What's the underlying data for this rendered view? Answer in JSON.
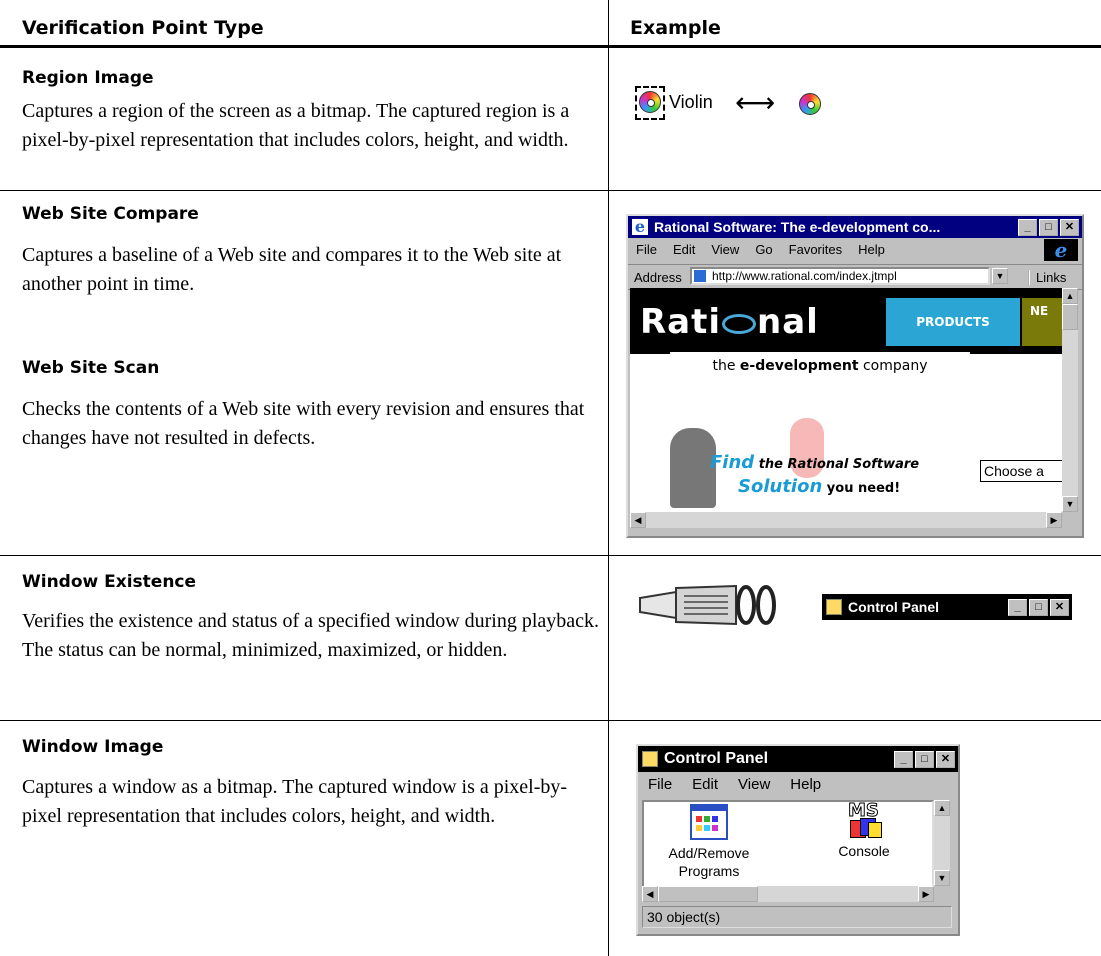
{
  "header": {
    "col1": "Verification Point Type",
    "col2": "Example"
  },
  "rows": [
    {
      "title": "Region Image",
      "desc": "Captures a region of the screen as a bitmap. The captured region is a pixel-by-pixel representation that includes colors, height, and width.",
      "example": {
        "label": "Violin",
        "arrow": "⟷"
      }
    },
    {
      "title": "Web Site Compare",
      "desc": "Captures a baseline of a Web site and compares it to the Web site at another point in time."
    },
    {
      "title": "Web Site Scan",
      "desc": "Checks the contents of a Web site with every revision and ensures that changes have not resulted in defects."
    },
    {
      "title": "Window Existence",
      "desc": "Verifies the existence and status of a specified window during playback. The status can be normal, minimized, maximized, or hidden."
    },
    {
      "title": "Window Image",
      "desc": "Captures a window as a bitmap. The captured window is a pixel-by-pixel representation that includes colors, height, and width."
    }
  ],
  "browser": {
    "title": "Rational Software: The e-development co...",
    "menu": [
      "File",
      "Edit",
      "View",
      "Go",
      "Favorites",
      "Help"
    ],
    "address_label": "Address",
    "url": "http://www.rational.com/index.jtmpl",
    "links_label": "Links",
    "logo": "Rati",
    "logo_tail": "nal",
    "products": "PRODUCTS",
    "ne": "NE",
    "tagline_pre": "the ",
    "tagline_bold": "e-development",
    "tagline_post": " company",
    "find": "Find",
    "find_rest": " the Rational Software",
    "solution": "Solution",
    "solution_rest": " you need!",
    "choose": "Choose a"
  },
  "small_window": {
    "title": "Control Panel"
  },
  "cp_window": {
    "title": "Control Panel",
    "menu": [
      "File",
      "Edit",
      "View",
      "Help"
    ],
    "icons": [
      {
        "label_line1": "Add/Remove",
        "label_line2": "Programs"
      },
      {
        "label_line1": "Console",
        "label_line2": ""
      }
    ],
    "ms_text": "MS",
    "status": "30 object(s)"
  },
  "colors": {
    "title_bar": "#000080",
    "window_face": "#c0c0c0",
    "link_blue": "#1a9bd6"
  }
}
